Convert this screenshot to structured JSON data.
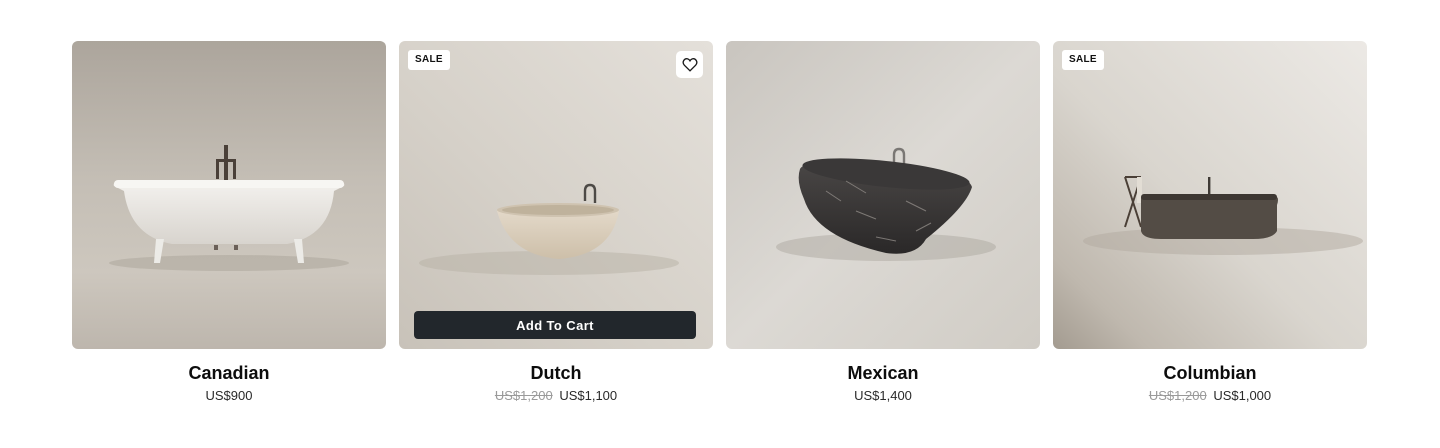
{
  "products": [
    {
      "name": "Canadian",
      "price": "US$900",
      "image_alt": "white clawfoot bathtub",
      "tone": "#b9b3aa"
    },
    {
      "name": "Dutch",
      "badge": "SALE",
      "compare_price": "US$1,200",
      "price": "US$1,100",
      "wishlist_icon": "heart-icon",
      "add_to_cart_label": "Add To Cart",
      "image_alt": "travertine bowl bathtub",
      "tone": "#d2cdc5"
    },
    {
      "name": "Mexican",
      "price": "US$1,400",
      "image_alt": "dark marble oval bathtub",
      "tone": "#cfcbc4"
    },
    {
      "name": "Columbian",
      "badge": "SALE",
      "compare_price": "US$1,200",
      "price": "US$1,000",
      "image_alt": "dark stone bathtub with towel rack",
      "tone": "#d7d3cc"
    }
  ],
  "colors": {
    "button_bg": "#22272c",
    "strike_price": "#9a9a9a",
    "text": "#111111"
  }
}
